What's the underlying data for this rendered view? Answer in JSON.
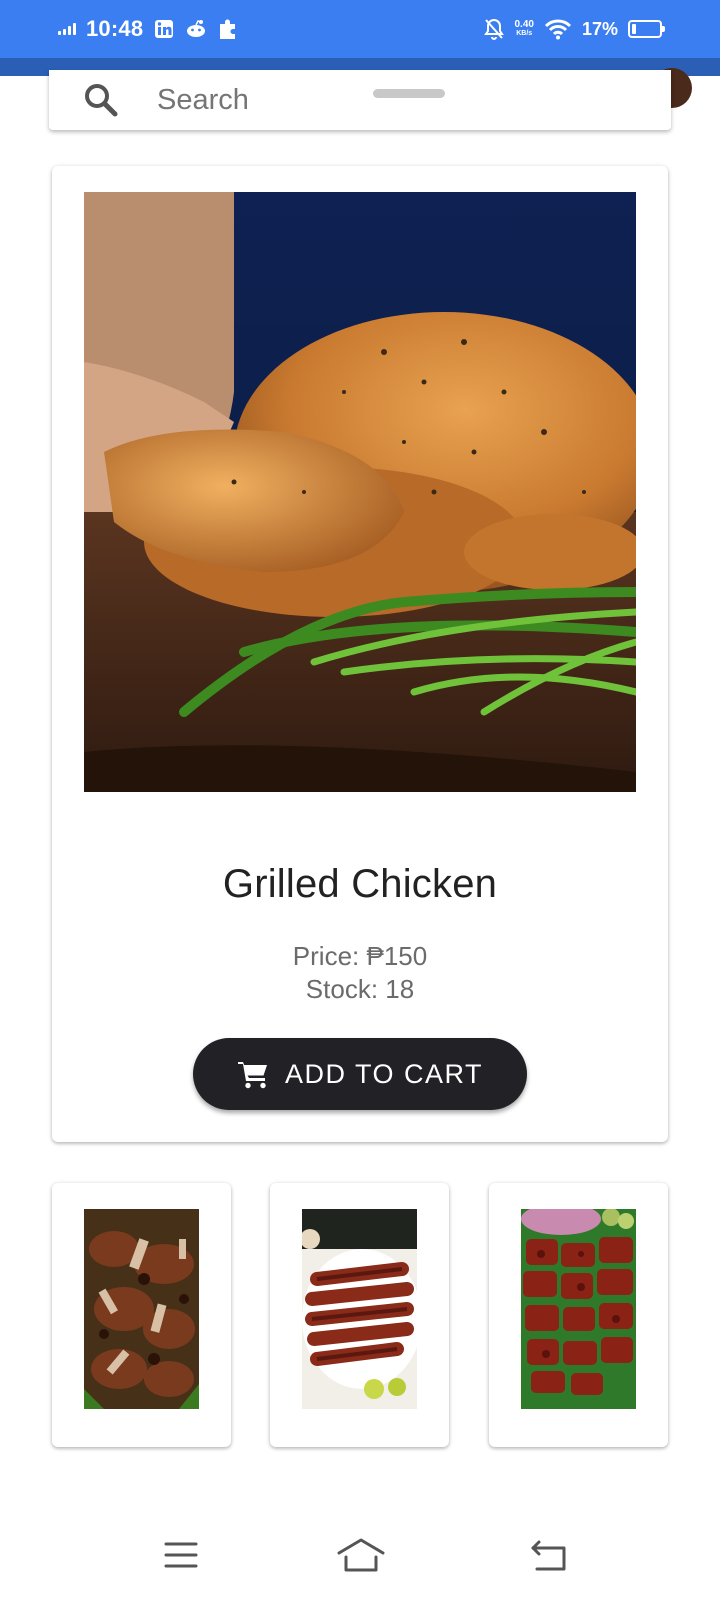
{
  "status_bar": {
    "time": "10:48",
    "net_speed_value": "0.40",
    "net_speed_unit": "KB/s",
    "battery_percent": "17%",
    "battery_level": 0.17,
    "notification_icons": [
      "linkedin-icon",
      "reddit-icon",
      "puzzle-icon"
    ],
    "right_icons": [
      "mute-bell-icon",
      "wifi-icon",
      "battery-icon"
    ]
  },
  "search": {
    "placeholder": "Search"
  },
  "product": {
    "name": "Grilled Chicken",
    "price": "Price: ₱150",
    "stock": "Stock: 18",
    "add_to_cart_label": "ADD TO CART"
  },
  "thumbnails": [
    {
      "image": "grilled-pork-image"
    },
    {
      "image": "bbq-skewers-image"
    },
    {
      "image": "pork-sisig-image"
    }
  ],
  "nav": {
    "icons": [
      "menu-icon",
      "home-icon",
      "back-icon"
    ]
  },
  "colors": {
    "status_bar": "#3b7ef2",
    "app_bar": "#2a5fb5",
    "button": "#222126",
    "price_text": "#6b6b6b"
  }
}
